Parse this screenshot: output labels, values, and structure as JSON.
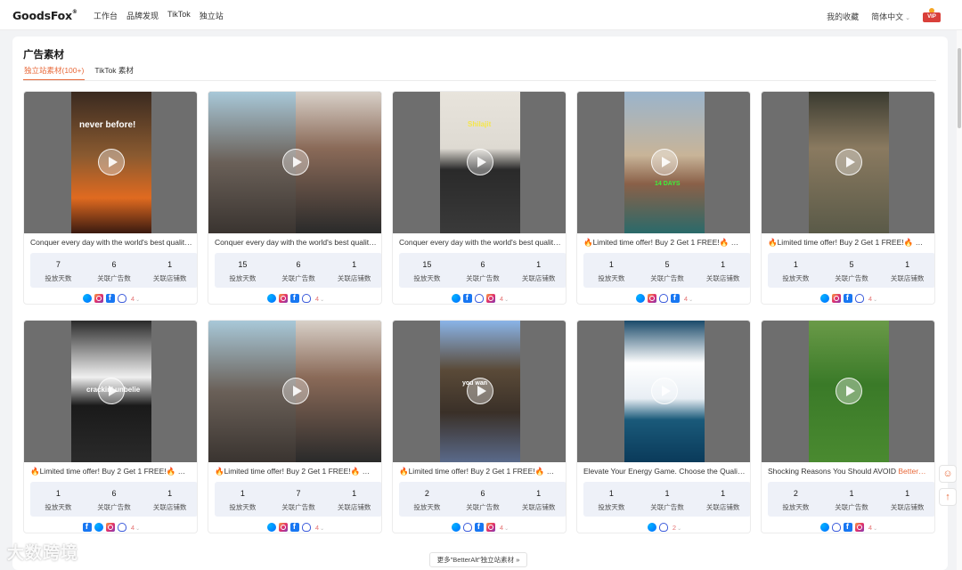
{
  "nav": {
    "logo": "GoodsFox",
    "logo_mark": "®",
    "links": [
      "工作台",
      "品牌发现",
      "TikTok",
      "独立站"
    ],
    "favorites": "我的收藏",
    "language": "简体中文",
    "vip": "VIP"
  },
  "page": {
    "title": "广告素材",
    "tabs": [
      {
        "label": "独立站素材(100+)",
        "active": true
      },
      {
        "label": "TikTok 素材",
        "active": false
      }
    ]
  },
  "stat_labels": [
    "投放天数",
    "关联广告数",
    "关联店铺数"
  ],
  "cards": [
    {
      "title": "Conquer every day with the world's best qualit…",
      "days": "7",
      "ads": "6",
      "stores": "1",
      "platforms": [
        "messenger-icon",
        "instagram-icon",
        "facebook-icon",
        "audience-network-icon"
      ],
      "count": "4",
      "overlay": "never before!"
    },
    {
      "title": "Conquer every day with the world's best qualit…",
      "days": "15",
      "ads": "6",
      "stores": "1",
      "platforms": [
        "messenger-icon",
        "instagram-icon",
        "facebook-icon",
        "audience-network-icon"
      ],
      "count": "4",
      "overlay": ""
    },
    {
      "title": "Conquer every day with the world's best qualit…",
      "days": "15",
      "ads": "6",
      "stores": "1",
      "platforms": [
        "messenger-icon",
        "facebook-icon",
        "audience-network-icon",
        "instagram-icon"
      ],
      "count": "4",
      "overlay": "Shilajit"
    },
    {
      "title": "🔥Limited time offer! Buy 2 Get 1 FREE!🔥 💥…",
      "days": "1",
      "ads": "5",
      "stores": "1",
      "platforms": [
        "messenger-icon",
        "instagram-icon",
        "audience-network-icon",
        "facebook-icon"
      ],
      "count": "4",
      "overlay": "14 DAYS"
    },
    {
      "title": "🔥Limited time offer! Buy 2 Get 1 FREE!🔥 💥…",
      "days": "1",
      "ads": "5",
      "stores": "1",
      "platforms": [
        "messenger-icon",
        "instagram-icon",
        "facebook-icon",
        "audience-network-icon"
      ],
      "count": "4",
      "overlay": ""
    },
    {
      "title": "🔥Limited time offer! Buy 2 Get 1 FREE!🔥 💥…",
      "days": "1",
      "ads": "6",
      "stores": "1",
      "platforms": [
        "facebook-icon",
        "messenger-icon",
        "instagram-icon",
        "audience-network-icon"
      ],
      "count": "4",
      "overlay": "crackin' unbelie"
    },
    {
      "title": "🔥Limited time offer! Buy 2 Get 1 FREE!🔥 💥…",
      "days": "1",
      "ads": "7",
      "stores": "1",
      "platforms": [
        "messenger-icon",
        "instagram-icon",
        "facebook-icon",
        "audience-network-icon"
      ],
      "count": "4",
      "overlay": ""
    },
    {
      "title": "🔥Limited time offer! Buy 2 Get 1 FREE!🔥 💥…",
      "days": "2",
      "ads": "6",
      "stores": "1",
      "platforms": [
        "messenger-icon",
        "audience-network-icon",
        "facebook-icon",
        "instagram-icon"
      ],
      "count": "4",
      "overlay": "you wan"
    },
    {
      "title": "Elevate Your Energy Game. Choose the Quali…",
      "days": "1",
      "ads": "1",
      "stores": "1",
      "platforms": [
        "messenger-icon",
        "audience-network-icon"
      ],
      "count": "2",
      "overlay": ""
    },
    {
      "title": "Shocking Reasons You Should AVOID ",
      "title_hl": "Better…",
      "days": "2",
      "ads": "1",
      "stores": "1",
      "platforms": [
        "messenger-icon",
        "audience-network-icon",
        "facebook-icon",
        "instagram-icon"
      ],
      "count": "4",
      "overlay": ""
    }
  ],
  "footer": {
    "more": "更多\"BetterAlt\"独立站素材 »",
    "watermark": "大数跨境"
  },
  "colors": {
    "accent": "#e8693a",
    "stats_bg": "#eef1f8"
  }
}
